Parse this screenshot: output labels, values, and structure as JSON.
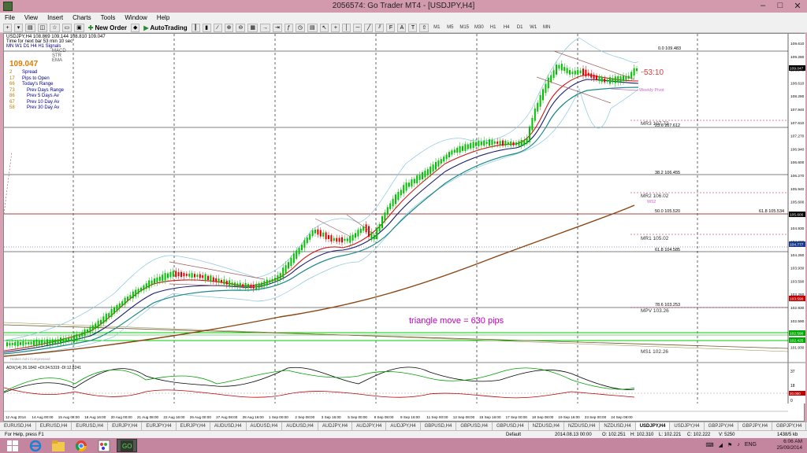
{
  "window": {
    "title": "2056574: Go Trader MT4 - [USDJPY,H4]"
  },
  "menu": [
    "File",
    "View",
    "Insert",
    "Charts",
    "Tools",
    "Window",
    "Help"
  ],
  "toolbar": {
    "new_order": "New Order",
    "autotrading": "AutoTrading",
    "timeframes": [
      "M1",
      "M5",
      "M15",
      "M30",
      "H1",
      "H4",
      "D1",
      "W1",
      "MN"
    ]
  },
  "chart_info": {
    "header": "USDJPY,H4  108.869 109.144 108.810 109.047",
    "time_next_bar": "Time for next bar 53 min 10 sec",
    "mini_tf": "MN  W1  D1  H4  H1  Signals",
    "mini_ind": [
      "MACD",
      "STR",
      "EMA"
    ],
    "price": "109.047",
    "stats": [
      {
        "n": "2",
        "label": "Spread"
      },
      {
        "n": "17",
        "label": "Pips to Open"
      },
      {
        "n": "66",
        "label": "Today's Range"
      },
      {
        "n": "73",
        "label": "Prev Days Range"
      },
      {
        "n": "86",
        "label": "Prev 5 Days Av"
      },
      {
        "n": "67",
        "label": "Prev 10 Day Av"
      },
      {
        "n": "58",
        "label": "Prev 30 Day Av"
      }
    ],
    "countdown": "53:10",
    "weekly_pivot": "Weekly Pivot",
    "annotation": "triangle move = 630 pips",
    "watermark": "Heiken Ashi Compressed"
  },
  "levels": [
    {
      "label": "0.0  109.483"
    },
    {
      "label": "MR3  107.72"
    },
    {
      "label": "23.6  107.612"
    },
    {
      "label": "38.2  106.455"
    },
    {
      "label": "MR2  106.02"
    },
    {
      "label": "W52"
    },
    {
      "label": "50.0  105.520"
    },
    {
      "label": "61.8  105.534"
    },
    {
      "label": "MR1  105.02"
    },
    {
      "label": "61.8  104.585"
    },
    {
      "label": "78.6  103.253"
    },
    {
      "label": "MPV  103.26"
    },
    {
      "label": "MS1  102.26"
    }
  ],
  "price_scale": [
    "109.610",
    "109.280",
    "108.940",
    "108.610",
    "108.280",
    "107.940",
    "107.610",
    "107.270",
    "106.940",
    "106.600",
    "106.270",
    "105.940",
    "105.600",
    "105.270",
    "104.930",
    "104.600",
    "104.260",
    "103.930",
    "103.590",
    "103.260",
    "102.930",
    "102.590",
    "102.260",
    "101.930"
  ],
  "price_tags": {
    "current": "109.047",
    "blue": "104.777",
    "red": "103.590",
    "green1": "102.590",
    "green2": "102.425",
    "black": "105.600"
  },
  "adx": {
    "header": "ADX(14) 26.1842 +DI:24.5319 -DI:12.8241",
    "scale": [
      "37",
      "18",
      "0"
    ],
    "level_tag": "20.000",
    "chart_data": {
      "type": "line",
      "series": [
        "ADX",
        "+DI",
        "-DI"
      ]
    }
  },
  "time_axis": [
    "12 Aug 2014",
    "14 Aug 00:00",
    "15 Aug 08:00",
    "18 Aug 16:00",
    "20 Aug 00:00",
    "21 Aug 08:00",
    "22 Aug 16:00",
    "26 Aug 00:00",
    "27 Aug 08:00",
    "28 Aug 16:00",
    "1 Sep 00:00",
    "2 Sep 08:00",
    "3 Sep 16:00",
    "5 Sep 00:00",
    "8 Sep 08:00",
    "9 Sep 16:00",
    "11 Sep 00:00",
    "12 Sep 08:00",
    "15 Sep 16:00",
    "17 Sep 00:00",
    "18 Sep 08:00",
    "19 Sep 16:00",
    "23 Sep 00:00",
    "24 Sep 08:00"
  ],
  "tabs": [
    "EURUSD,H4",
    "EURUSD,H4",
    "EURUSD,H4",
    "EURJPY,H4",
    "EURJPY,H4",
    "EURJPY,H4",
    "AUDUSD,H4",
    "AUDUSD,H4",
    "AUDUSD,H4",
    "AUDJPY,H4",
    "AUDJPY,H4",
    "AUDJPY,H4",
    "GBPUSD,H4",
    "GBPUSD,H4",
    "GBPUSD,H4",
    "NZDUSD,H4",
    "NZDUSD,H4",
    "NZDUSD,H4",
    "USDJPY,H4",
    "USDJPY,H4",
    "GBPJPY,H4",
    "GBPJPY,H4",
    "GBPJPY,H4"
  ],
  "active_tab_index": 18,
  "status": {
    "help": "For Help, press F1",
    "profile": "Default",
    "time": "2014.08.13 00:00",
    "o": "O: 102.251",
    "h": "H: 102.310",
    "l": "L: 102.221",
    "c": "C: 102.222",
    "v": "V: 5250",
    "kb": "1438/5 kb"
  },
  "taskbar": {
    "lang": "ENG",
    "time": "6:06 AM",
    "date": "25/09/2014"
  }
}
